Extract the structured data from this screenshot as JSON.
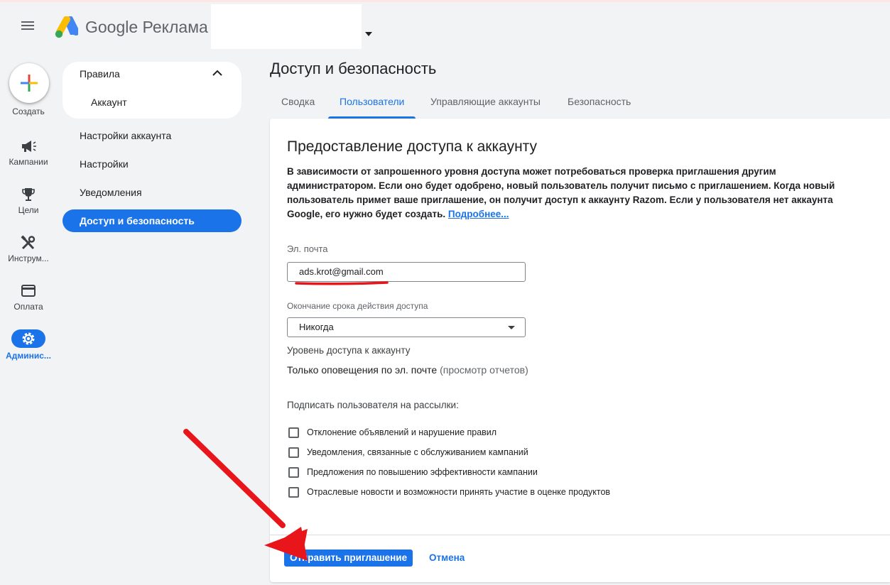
{
  "header": {
    "brand": "Google Реклама",
    "menu_icon": "hamburger-menu-icon"
  },
  "rail": {
    "create_label": "Создать",
    "items": [
      {
        "label": "Кампании",
        "icon": "megaphone-icon"
      },
      {
        "label": "Цели",
        "icon": "trophy-icon"
      },
      {
        "label": "Инструм...",
        "icon": "tools-icon"
      },
      {
        "label": "Оплата",
        "icon": "credit-card-icon"
      },
      {
        "label": "Админис...",
        "icon": "gear-icon"
      }
    ]
  },
  "subnav": {
    "group_title": "Правила",
    "group_sub": "Аккаунт",
    "items": [
      {
        "label": "Настройки аккаунта"
      },
      {
        "label": "Настройки"
      },
      {
        "label": "Уведомления"
      },
      {
        "label": "Доступ и безопасность"
      }
    ]
  },
  "main": {
    "title": "Доступ и безопасность",
    "tabs": [
      {
        "label": "Сводка"
      },
      {
        "label": "Пользователи"
      },
      {
        "label": "Управляющие аккаунты"
      },
      {
        "label": "Безопасность"
      }
    ]
  },
  "card": {
    "title": "Предоставление доступа к аккаунту",
    "description": "В зависимости от запрошенного уровня доступа может потребоваться проверка приглашения другим администратором. Если оно будет одобрено, новый пользователь получит письмо с приглашением. Когда новый пользователь примет ваше приглашение, он получит доступ к аккаунту Razom. Если у пользователя нет аккаунта Google, его нужно будет создать.",
    "learn_more": "Подробнее...",
    "email_label": "Эл. почта",
    "email_value": "ads.krot@gmail.com",
    "expiry_label": "Окончание срока действия доступа",
    "expiry_value": "Никогда",
    "access_level_label": "Уровень доступа к аккаунту",
    "access_level_value": "Только оповещения по эл. почте",
    "access_level_note": "(просмотр отчетов)",
    "subscribe_label": "Подписать пользователя на рассылки:",
    "checkboxes": [
      {
        "label": "Отклонение объявлений и нарушение правил",
        "checked": false
      },
      {
        "label": "Уведомления, связанные с обслуживанием кампаний",
        "checked": false
      },
      {
        "label": "Предложения по повышению эффективности кампании",
        "checked": false
      },
      {
        "label": "Отраслевые новости и возможности принять участие в оценке продуктов",
        "checked": false
      }
    ],
    "send_button": "Отправить приглашение",
    "cancel_button": "Отмена"
  },
  "annotations": {
    "arrow_color": "#e8151b",
    "underline_color": "#e8151b"
  }
}
